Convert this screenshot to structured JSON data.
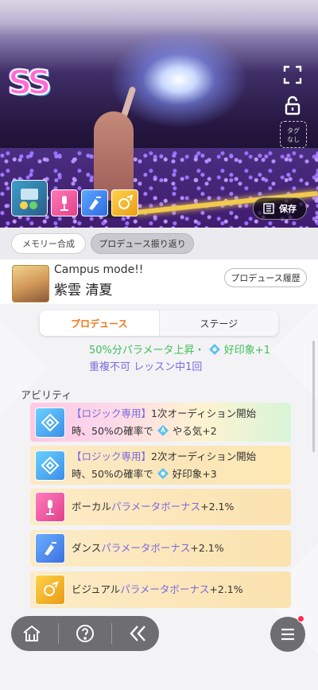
{
  "hero": {
    "rank_badge": "SS",
    "tag_label_line1": "タグ",
    "tag_label_line2": "なし",
    "save_label": "保存"
  },
  "tabs": {
    "memory_label": "メモリー合成",
    "review_label": "プロデュース振り返り"
  },
  "card": {
    "title": "Campus mode!!",
    "character_name": "紫雲 清夏",
    "history_label": "プロデュース履歴"
  },
  "segments": {
    "produce_label": "プロデュース",
    "stage_label": "ステージ"
  },
  "skill_text": {
    "line1": "50%分パラメータ上昇・",
    "line1_tail": "好印象+1",
    "line2": "重複不可 レッスン中1回"
  },
  "abilities": {
    "section_title": "アビリティ",
    "items": [
      {
        "tag": "【ロジック専用】",
        "text1": "1次オーディション開始",
        "text2a": "時、50%の確率で",
        "text2b": "やる気+2",
        "icon": "logic-icon"
      },
      {
        "tag": "【ロジック専用】",
        "text1": "2次オーディション開始",
        "text2a": "時、50%の確率で",
        "text2b": "好印象+3",
        "icon": "logic-icon"
      },
      {
        "prefix": "ボーカル",
        "bonus": "パラメータボーナス",
        "value": "+2.1%",
        "icon": "vocal-icon"
      },
      {
        "prefix": "ダンス",
        "bonus": "パラメータボーナス",
        "value": "+2.1%",
        "icon": "dance-icon"
      },
      {
        "prefix": "ビジュアル",
        "bonus": "パラメータボーナス",
        "value": "+2.1%",
        "icon": "visual-icon"
      }
    ]
  },
  "colors": {
    "accent_orange": "#f07818",
    "param_purple": "#7a6ae0",
    "param_green": "#3fbf57",
    "nav_gray": "#6d6d72"
  },
  "nav": {
    "home_icon": "home-icon",
    "help_icon": "help-icon",
    "back_icon": "double-chevron-left-icon",
    "menu_icon": "hamburger-icon"
  }
}
